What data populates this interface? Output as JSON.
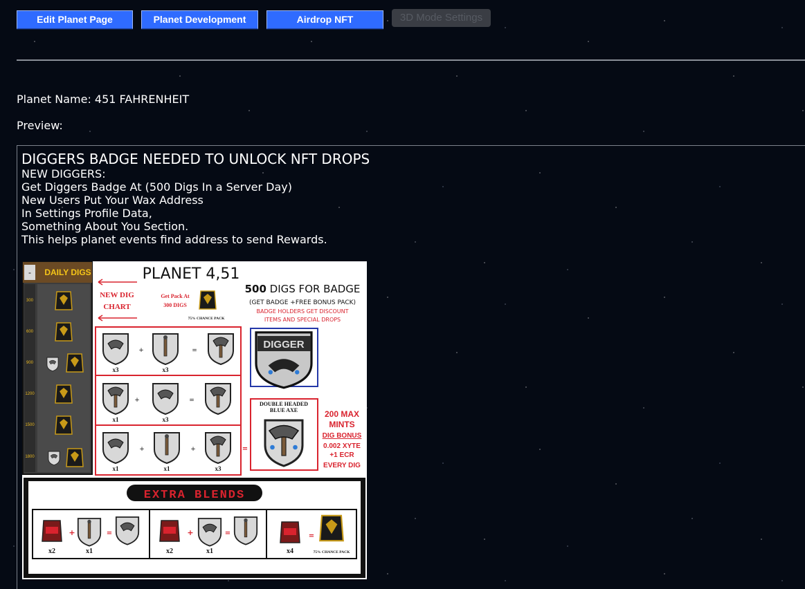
{
  "toolbar": {
    "edit_label": "Edit Planet Page",
    "dev_label": "Planet Development",
    "airdrop_label": "Airdrop NFT",
    "mode3d_label": "3D Mode Settings"
  },
  "planet": {
    "name_line": "Planet Name: 451 FAHRENHEIT",
    "preview_label": "Preview:"
  },
  "preview": {
    "heading": "DIGGERS BADGE NEEDED TO UNLOCK NFT DROPS",
    "lines": [
      "NEW DIGGERS:",
      "Get Diggers Badge At (500 Digs In a Server Day)",
      "New Users Put Your Wax Address",
      "In Settings Profile Data,",
      "Something About You Section.",
      "This helps planet events find address to send Rewards."
    ]
  },
  "poster": {
    "daily_digs": "DAILY DIGS",
    "scale": [
      "300",
      "600",
      "900",
      "1200",
      "1500",
      "1800"
    ],
    "title": "PLANET 4,51",
    "new_dig_chart": [
      "NEW DIG",
      "CHART"
    ],
    "get_pack": [
      "Get Pack At",
      "300 DIGS"
    ],
    "chance_pack": "75% CHANCE PACK",
    "badge_title_bold": "500",
    "badge_title_rest": " DIGS FOR BADGE",
    "badge_sub1": "(GET BADGE +FREE BONUS PACK)",
    "badge_sub2": "BADGE HOLDERS GET DISCOUNT",
    "badge_sub3": "ITEMS AND SPECIAL DROPS",
    "digger_badge": "DIGGER",
    "double_axe": [
      "DOUBLE HEADED",
      "BLUE AXE"
    ],
    "max_mints": [
      "200 MAX",
      "MINTS"
    ],
    "dig_bonus": "DIG BONUS",
    "bonus_lines": [
      "0.002 XYTE",
      "+1 ECR",
      "EVERY DIG"
    ],
    "extra_blends": "EXTRA BLENDS",
    "recipe_counts": [
      [
        "x3",
        "x3"
      ],
      [
        "x1",
        "x3"
      ],
      [
        "x1",
        "x1",
        "x3"
      ]
    ],
    "blend_counts": [
      [
        "x2",
        "x1"
      ],
      [
        "x2",
        "x1"
      ],
      [
        "x4"
      ]
    ],
    "colors": {
      "red": "#d9232e",
      "blue": "#2438a8",
      "dark_panel": "#3c3c3c",
      "gold": "#e8b820"
    }
  }
}
